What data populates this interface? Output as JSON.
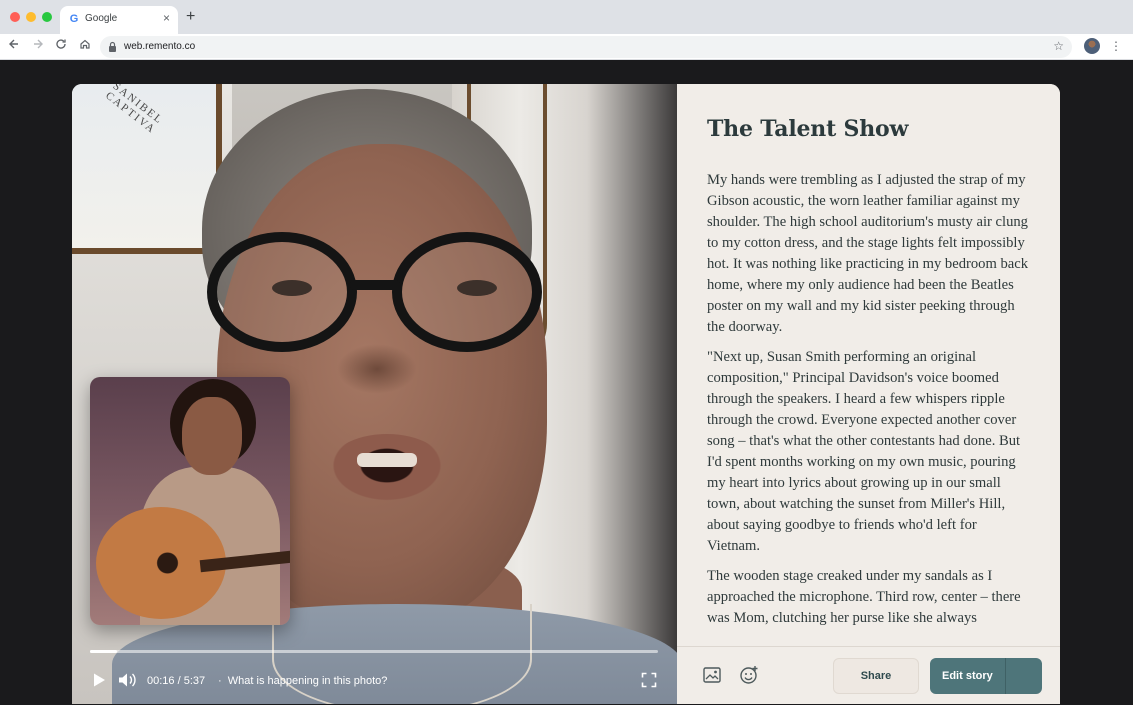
{
  "browser": {
    "tab_title": "Google",
    "tab_favicon": "G",
    "new_tab": "+",
    "close_tab": "×",
    "url": "web.remento.co"
  },
  "player": {
    "current_time": "00:16",
    "duration": "5:37",
    "time_display": "00:16 / 5:37",
    "separator": "·",
    "prompt": "What is happening in this photo?",
    "progress": 0.0475
  },
  "story": {
    "title": "The Talent Show",
    "paragraphs": [
      "My hands were trembling as I adjusted the strap of my Gibson acoustic, the worn leather familiar against my shoulder. The high school auditorium's musty air clung to my cotton dress, and the stage lights felt impossibly hot. It was nothing like practicing in my bedroom back home, where my only audience had been the Beatles poster on my wall and my kid sister peeking through the doorway.",
      "\"Next up, Susan Smith performing an original composition,\" Principal Davidson's voice boomed through the speakers. I heard a few whispers ripple through the crowd. Everyone expected another cover song – that's what the other contestants had done. But I'd spent months working on my own music, pouring my heart into lyrics about growing up in our small town, about watching the sunset from Miller's Hill, about saying goodbye to friends who'd left for Vietnam.",
      "The wooden stage creaked under my sandals as I approached the microphone. Third row, center – there was Mom, clutching her purse like she always"
    ]
  },
  "footer": {
    "share_label": "Share",
    "edit_label": "Edit story"
  },
  "poster_text": "SANIBEL  CAPTIVA",
  "colors": {
    "accent": "#4e757a",
    "panel_bg": "#f1ede8",
    "text": "#2f3a3b"
  }
}
